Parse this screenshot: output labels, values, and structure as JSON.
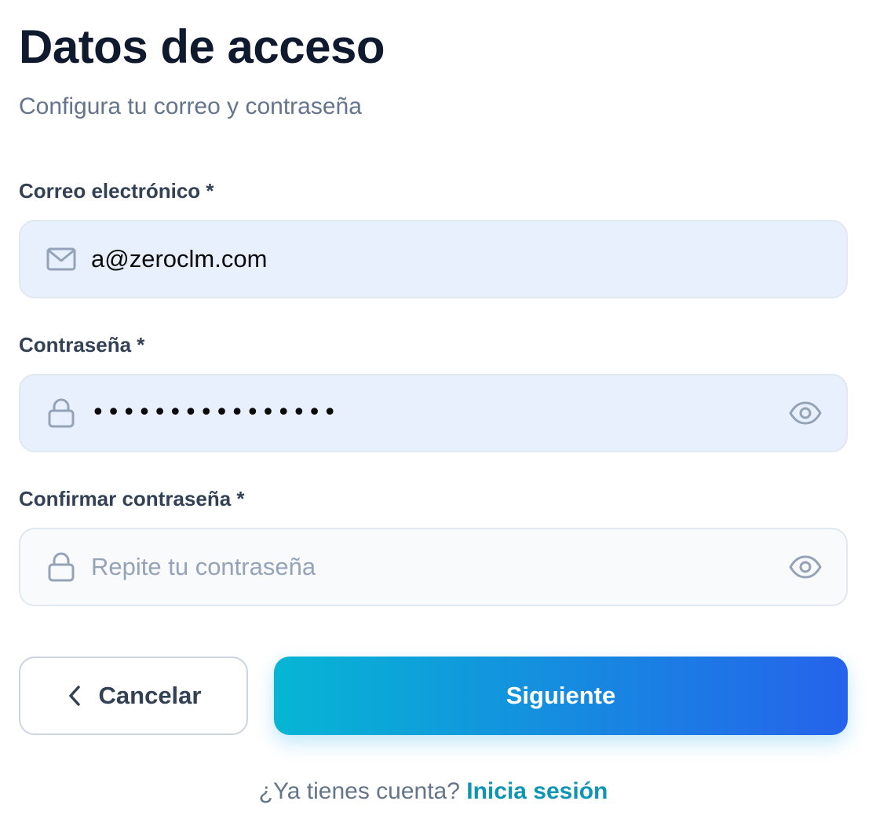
{
  "header": {
    "title": "Datos de acceso",
    "subtitle": "Configura tu correo y contraseña"
  },
  "form": {
    "email": {
      "label": "Correo electrónico *",
      "value": "a@zeroclm.com",
      "icon": "mail-icon"
    },
    "password": {
      "label": "Contraseña *",
      "masked_value": "••••••••••••••••",
      "icon": "lock-icon",
      "toggle_icon": "eye-icon"
    },
    "confirm_password": {
      "label": "Confirmar contraseña *",
      "placeholder": "Repite tu contraseña",
      "value": "",
      "icon": "lock-icon",
      "toggle_icon": "eye-icon"
    }
  },
  "actions": {
    "cancel_label": "Cancelar",
    "cancel_icon": "chevron-left-icon",
    "next_label": "Siguiente"
  },
  "footer": {
    "prompt": "¿Ya tienes cuenta?",
    "link": "Inicia sesión"
  },
  "colors": {
    "title": "#0f1a2e",
    "muted": "#64748b",
    "label": "#334155",
    "filled_field_bg": "#e8f0fe",
    "empty_field_bg": "#f8fafc",
    "field_border": "#e2e8f0",
    "icon": "#94a3b8",
    "gradient_start": "#06b6d4",
    "gradient_end": "#2563eb",
    "link": "#0e95b3"
  }
}
